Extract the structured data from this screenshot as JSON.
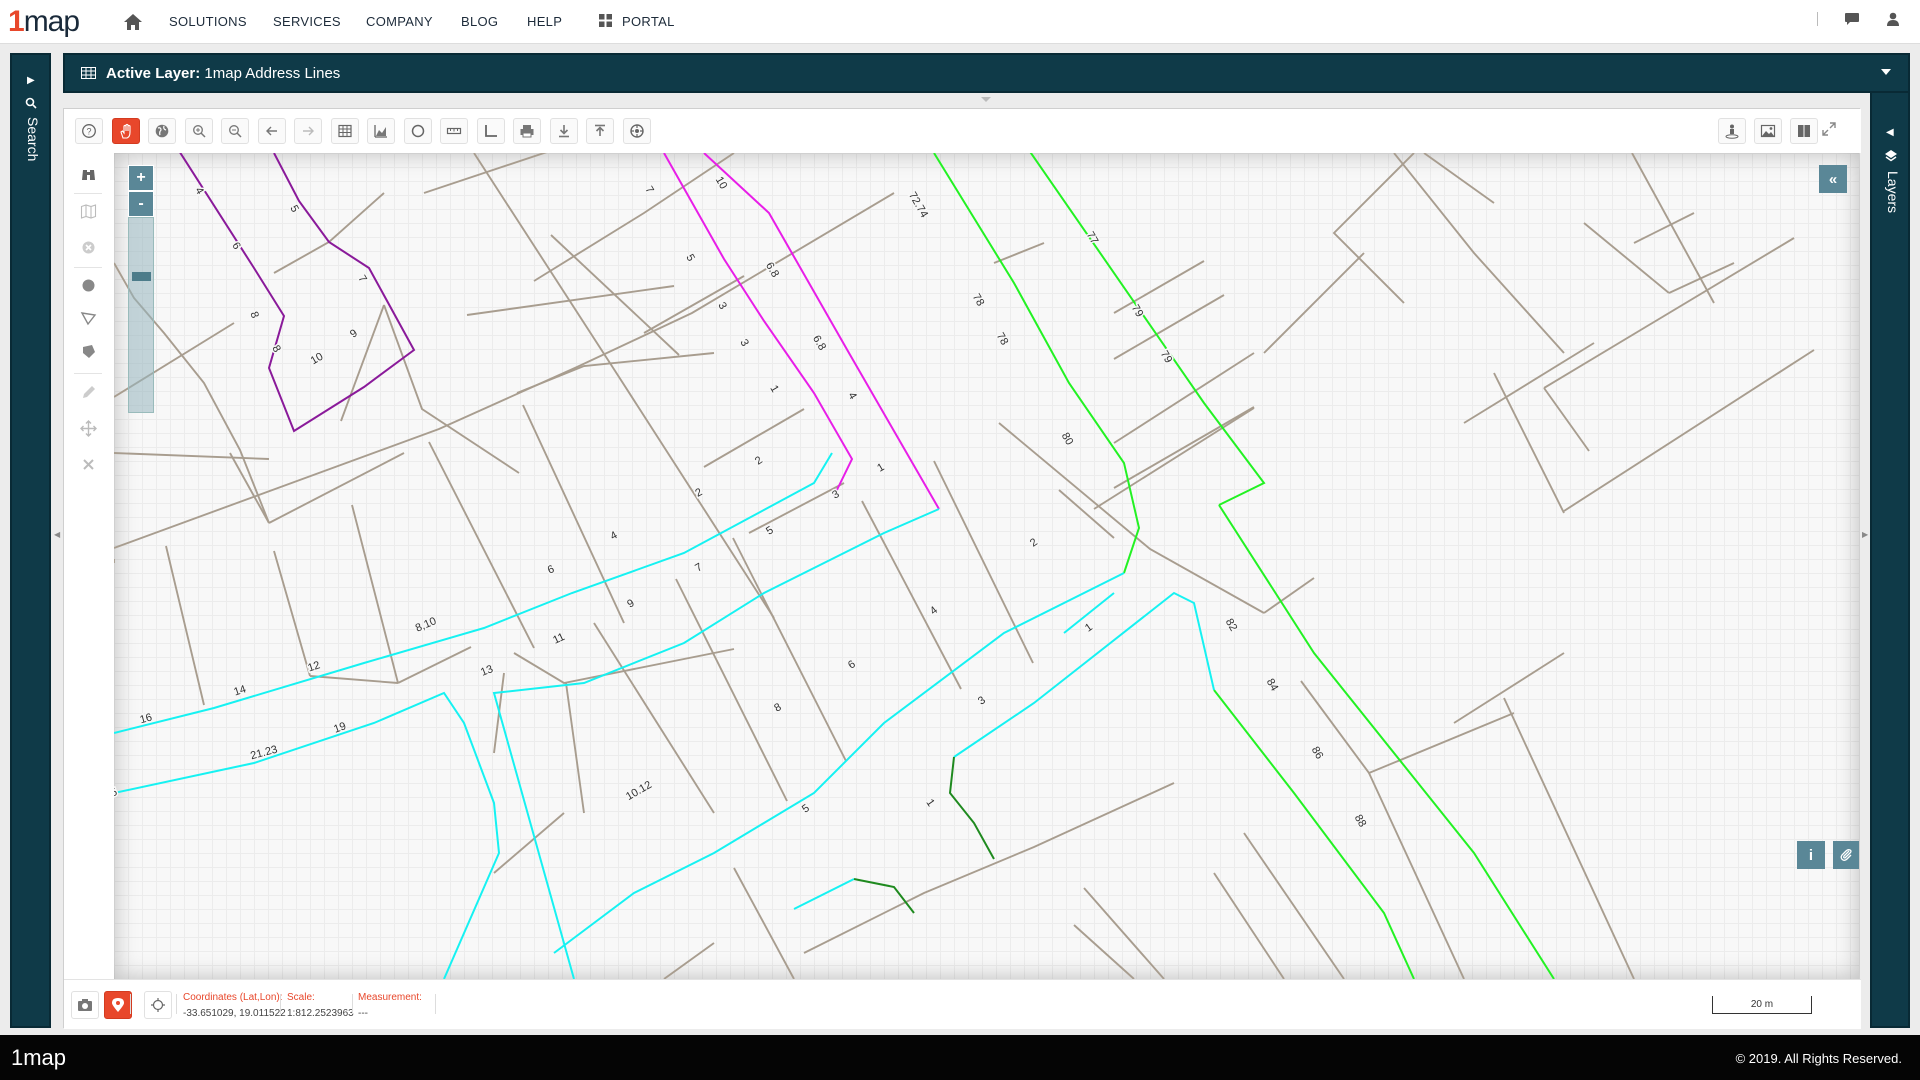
{
  "brand": {
    "logo_mark": "1",
    "logo_text": "map",
    "accent": "#e8472b",
    "panel_color": "#0f3a48"
  },
  "nav": {
    "items": [
      "SOLUTIONS",
      "SERVICES",
      "COMPANY",
      "BLOG",
      "HELP"
    ],
    "portal": "PORTAL",
    "icons": [
      "home-icon",
      "portal-grid-icon",
      "chat-icon",
      "user-icon"
    ]
  },
  "left_panel": {
    "label": "Search"
  },
  "right_panel": {
    "label": "Layers"
  },
  "layer_bar": {
    "prefix": "Active Layer:",
    "value": "1map Address Lines"
  },
  "toolbar": {
    "left_icons": [
      "help-icon",
      "pan-hand-icon",
      "globe-icon",
      "zoom-in-icon",
      "zoom-out-icon",
      "back-arrow-icon",
      "forward-arrow-icon",
      "table-icon",
      "chart-icon",
      "circle-select-icon",
      "ruler-icon",
      "angle-measure-icon",
      "print-icon",
      "download-icon",
      "upload-icon",
      "settings-icon"
    ],
    "right_icons": [
      "street-person-icon",
      "image-export-icon",
      "split-view-icon",
      "fullscreen-icon"
    ]
  },
  "left_tools": [
    "binoculars-icon",
    "map-sheet-icon",
    "clear-icon",
    "polygon-circle-icon",
    "polygon-draw-icon",
    "polygon-select-icon",
    "pencil-icon",
    "move-icon",
    "delete-icon"
  ],
  "map": {
    "zoom_in": "+",
    "zoom_out": "-",
    "collapse": "«",
    "info": "i",
    "labels": {
      "magenta_a": [
        "4",
        "6",
        "8",
        "8",
        "10",
        "9",
        "7",
        "5"
      ],
      "magenta_b": [
        "7",
        "5",
        "3",
        "3",
        "1"
      ],
      "magenta_c": [
        "10",
        "6.8",
        "6.8",
        "4"
      ],
      "green_a": [
        "72.74",
        "78",
        "78",
        "80"
      ],
      "green_b": [
        "77",
        "79",
        "79"
      ],
      "green_c": [
        "82",
        "84",
        "86",
        "88"
      ],
      "cyan_a": [
        "16",
        "14",
        "12",
        "8,10",
        "6",
        "4",
        "2",
        "2"
      ],
      "cyan_b": [
        "13",
        "11",
        "9",
        "7",
        "5",
        "3",
        "1"
      ],
      "cyan_c": [
        "19",
        "21.23",
        "5"
      ],
      "cyan_d": [
        "10.12",
        "8",
        "6",
        "4",
        "2"
      ],
      "cyan_e": [
        "3",
        "1"
      ],
      "darkgreen": [
        "1",
        "5"
      ]
    }
  },
  "status": {
    "coords_label": "Coordinates (Lat,Lon):",
    "coords_value": "-33.651029, 19.011522",
    "scale_label": "Scale:",
    "scale_value": "1:812.2523963",
    "measure_label": "Measurement:",
    "measure_value": "---",
    "scalebar": "20 m"
  },
  "footer": {
    "logo": "1map",
    "copyright": "© 2019. All Rights Reserved."
  }
}
